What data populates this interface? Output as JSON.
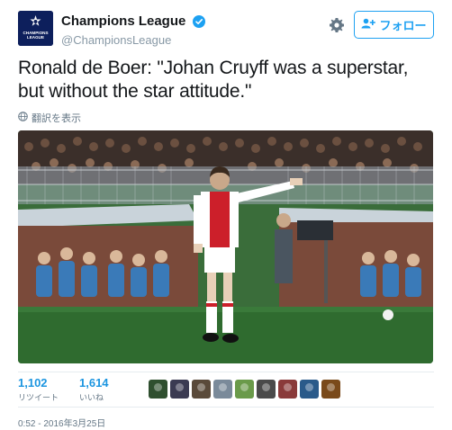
{
  "header": {
    "display_name": "Champions League",
    "handle": "@ChampionsLeague",
    "avatar_text_line1": "CHAMPIONS",
    "avatar_text_line2": "LEAGUE",
    "verified_icon": "verified-badge-icon",
    "settings_icon": "gear-icon",
    "follow_label": "フォロー",
    "follow_icon": "add-user-icon",
    "brand_color": "#0d1f5c",
    "accent_color": "#1da1f2"
  },
  "tweet": {
    "text": "Ronald de Boer: \"Johan Cruyff was a superstar, but without the star attitude.\"",
    "translate_label": "翻訳を表示",
    "translate_icon": "globe-icon"
  },
  "photo": {
    "description_icon": "photo-icon"
  },
  "stats": {
    "retweets": {
      "count": "1,102",
      "label": "リツイート"
    },
    "likes": {
      "count": "1,614",
      "label": "いいね"
    }
  },
  "likers": [
    {
      "color": "#2f4f2f"
    },
    {
      "color": "#3b3b52"
    },
    {
      "color": "#5a4a3a"
    },
    {
      "color": "#7a8a9a"
    },
    {
      "color": "#6a9a4a"
    },
    {
      "color": "#4a4a4a"
    },
    {
      "color": "#8a3a3a"
    },
    {
      "color": "#2a5a8a"
    },
    {
      "color": "#7a4a1a"
    }
  ],
  "meta": {
    "timestamp": "0:52 - 2016年3月25日"
  }
}
